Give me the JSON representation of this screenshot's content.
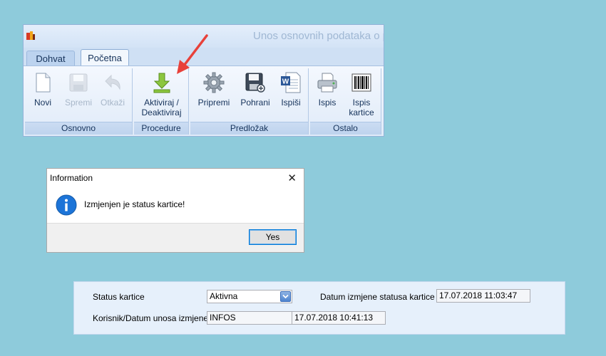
{
  "window": {
    "title": "Unos osnovnih podataka o p"
  },
  "tabs": [
    {
      "label": "Dohvat",
      "active": false
    },
    {
      "label": "Početna",
      "active": true
    }
  ],
  "ribbon": {
    "groups": [
      {
        "label": "Osnovno",
        "buttons": [
          {
            "label": "Novi",
            "icon": "new-document-icon",
            "enabled": true
          },
          {
            "label": "Spremi",
            "icon": "save-disk-icon",
            "enabled": false
          },
          {
            "label": "Otkaži",
            "icon": "undo-arrow-icon",
            "enabled": false
          }
        ]
      },
      {
        "label": "Procedure",
        "buttons": [
          {
            "label": "Aktiviraj /\nDeaktiviraj",
            "icon": "download-arrow-icon",
            "enabled": true
          }
        ]
      },
      {
        "label": "Predložak",
        "buttons": [
          {
            "label": "Pripremi",
            "icon": "gear-icon",
            "enabled": true
          },
          {
            "label": "Pohrani",
            "icon": "save-disk-icon",
            "enabled": true
          },
          {
            "label": "Ispiši",
            "icon": "word-document-icon",
            "enabled": true
          }
        ]
      },
      {
        "label": "Ostalo",
        "buttons": [
          {
            "label": "Ispis",
            "icon": "printer-icon",
            "enabled": true
          },
          {
            "label": "Ispis\nkartice",
            "icon": "barcode-icon",
            "enabled": true
          }
        ]
      }
    ]
  },
  "annotation": {
    "arrow_color": "#e8413a"
  },
  "dialog": {
    "title": "Information",
    "close_glyph": "✕",
    "message": "Izmjenjen je status kartice!",
    "yes_label": "Yes",
    "icon": "info-icon"
  },
  "status_panel": {
    "status_label": "Status kartice",
    "status_value": "Aktivna",
    "date_label": "Datum izmjene statusa kartice",
    "date_value": "17.07.2018 11:03:47",
    "user_label": "Korisnik/Datum unosa izmjene",
    "user_value": "INFOS",
    "user_date_value": "17.07.2018 10:41:13"
  },
  "colors": {
    "background": "#8ecbdb",
    "ribbon": "#dfeaf8",
    "accent": "#0078d7"
  }
}
